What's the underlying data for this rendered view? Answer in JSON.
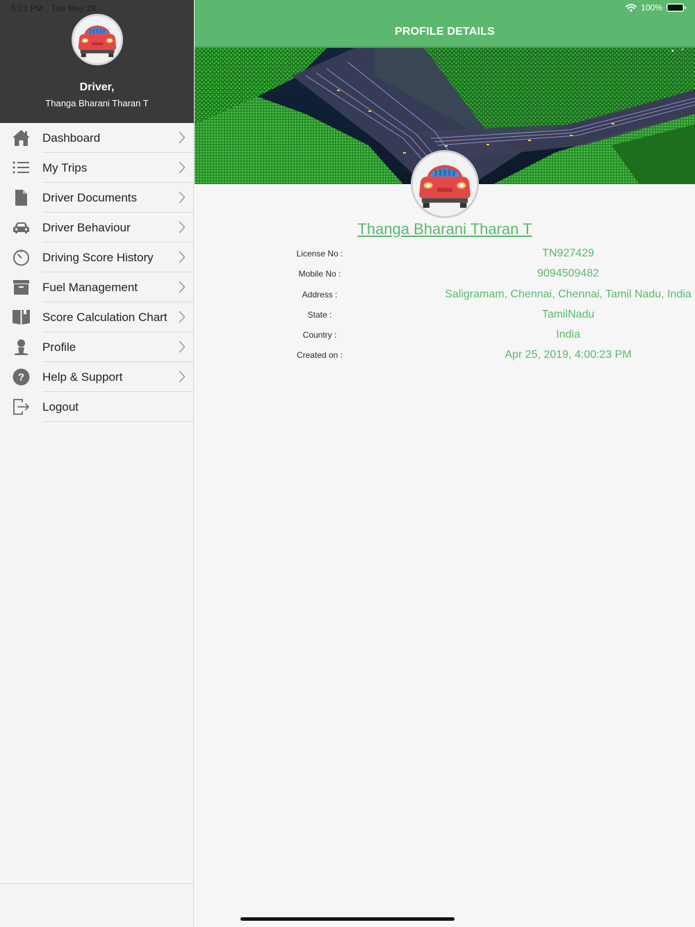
{
  "status": {
    "time": "5:21 PM",
    "date": "Tue May 28",
    "battery": "100%"
  },
  "sidebar": {
    "role": "Driver,",
    "name": "Thanga Bharani Tharan T",
    "avatar_icon": "car-front-icon",
    "items": [
      {
        "label": "Dashboard",
        "icon": "home-icon",
        "chevron": true
      },
      {
        "label": "My Trips",
        "icon": "list-icon",
        "chevron": true
      },
      {
        "label": "Driver Documents",
        "icon": "document-icon",
        "chevron": true
      },
      {
        "label": "Driver Behaviour",
        "icon": "car-icon",
        "chevron": true
      },
      {
        "label": "Driving Score History",
        "icon": "timer-icon",
        "chevron": true
      },
      {
        "label": "Fuel Management",
        "icon": "archive-box-icon",
        "chevron": true
      },
      {
        "label": "Score Calculation Chart",
        "icon": "book-icon",
        "chevron": true
      },
      {
        "label": "Profile",
        "icon": "person-icon",
        "chevron": true
      },
      {
        "label": "Help & Support",
        "icon": "question-icon",
        "chevron": true
      },
      {
        "label": "Logout",
        "icon": "logout-icon",
        "chevron": false
      }
    ]
  },
  "main": {
    "title": "PROFILE DETAILS",
    "banner_image": "lidar-intersection-banner",
    "profile_name": "Thanga Bharani Tharan T",
    "details": [
      {
        "key": "License No :",
        "value": "TN927429"
      },
      {
        "key": "Mobile No :",
        "value": "9094509482"
      },
      {
        "key": "Address :",
        "value": "Saligramam, Chennai, Chennai, Tamil Nadu, India"
      },
      {
        "key": "State :",
        "value": "TamilNadu"
      },
      {
        "key": "Country :",
        "value": "India"
      },
      {
        "key": "Created on :",
        "value": "Apr 25, 2019, 4:00:23 PM"
      }
    ]
  },
  "colors": {
    "accent": "#5cb86e",
    "sidebar_header": "#3a3a3a",
    "background": "#f5f6f5"
  }
}
